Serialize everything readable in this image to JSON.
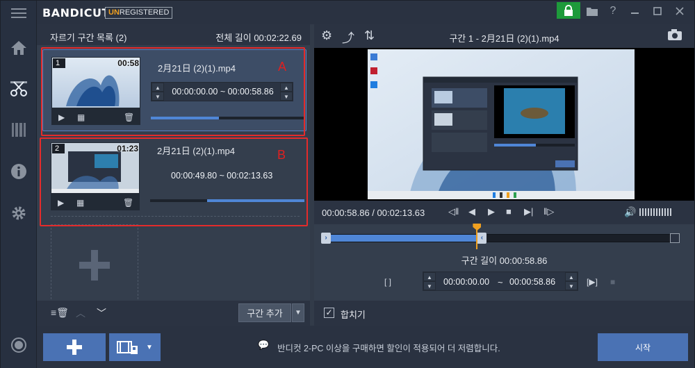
{
  "app": {
    "logo": "BANDICUT",
    "badge_un": "UN",
    "badge_rest": "REGISTERED"
  },
  "left_panel": {
    "title": "자르기 구간 목록 (2)",
    "total_length": "전체 길이 00:02:22.69",
    "clips": [
      {
        "number": "1",
        "duration": "00:58",
        "filename": "2月21日 (2)(1).mp4",
        "range": "00:00:00.00 ~ 00:00:58.86",
        "marker": "A",
        "progress_start": 0.0,
        "progress_end": 0.44
      },
      {
        "number": "2",
        "duration": "01:23",
        "filename": "2月21日 (2)(1).mp4",
        "range": "00:00:49.80 ~ 00:02:13.63",
        "marker": "B",
        "progress_start": 0.37,
        "progress_end": 1.0
      }
    ],
    "add_segment": "구간 추가"
  },
  "right_panel": {
    "title": "구간 1 - 2月21日 (2)(1).mp4",
    "time_display": "00:00:58.86 / 00:02:13.63",
    "segment_length": "구간 길이 00:00:58.86",
    "start_tc": "00:00:00.00",
    "tilde": "~",
    "end_tc": "00:00:58.86",
    "merge_label": "합치기",
    "merge_checked": "✓",
    "playhead_fraction": 0.44
  },
  "bottom": {
    "notice": "반디컷 2-PC 이상을 구매하면 할인이 적용되어 더 저렴합니다.",
    "start_label": "시작"
  },
  "colors": {
    "accent": "#4a72b4",
    "progress": "#4f86d6",
    "marker_red": "#e52b2b",
    "lock_green": "#1e9a3b",
    "playhead": "#f0a020"
  }
}
